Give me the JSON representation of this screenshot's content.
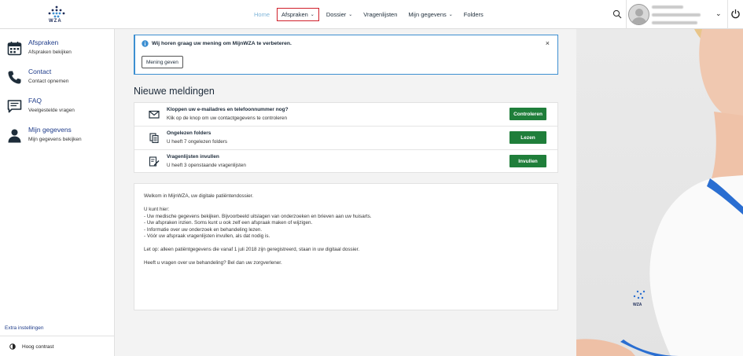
{
  "header": {
    "logo_text": "WZA",
    "nav": [
      {
        "label": "Home",
        "has_menu": false
      },
      {
        "label": "Afspraken",
        "has_menu": true
      },
      {
        "label": "Dossier",
        "has_menu": true
      },
      {
        "label": "Vragenlijsten",
        "has_menu": false
      },
      {
        "label": "Mijn gegevens",
        "has_menu": true
      },
      {
        "label": "Folders",
        "has_menu": false
      }
    ]
  },
  "sidebar": {
    "items": [
      {
        "title": "Afspraken",
        "subtitle": "Afspraken bekijken",
        "icon": "calendar-icon"
      },
      {
        "title": "Contact",
        "subtitle": "Contact opnemen",
        "icon": "phone-icon"
      },
      {
        "title": "FAQ",
        "subtitle": "Veelgestelde vragen",
        "icon": "chat-icon"
      },
      {
        "title": "Mijn gegevens",
        "subtitle": "Mijn gegevens bekijken",
        "icon": "person-icon"
      }
    ],
    "extra_label": "Extra instellingen",
    "contrast_label": "Hoog contrast"
  },
  "notice": {
    "text": "Wij horen graag uw mening om MijnWZA te verbeteren.",
    "button": "Mening geven"
  },
  "section_title": "Nieuwe meldingen",
  "notifications": [
    {
      "title": "Kloppen uw e-mailadres en telefoonnummer nog?",
      "subtitle": "Klik op de knop om uw contactgegevens te controleren",
      "button": "Controleren",
      "icon": "mail-icon"
    },
    {
      "title": "Ongelezen folders",
      "subtitle": "U heeft 7 ongelezen folders",
      "button": "Lezen",
      "icon": "folders-icon"
    },
    {
      "title": "Vragenlijsten invullen",
      "subtitle": "U heeft 3 openstaande vragenlijsten",
      "button": "Invullen",
      "icon": "form-edit-icon"
    }
  ],
  "welcome": {
    "intro": "Welkom in MijnWZA, uw digitale patiëntendossier.",
    "lead": "U kunt hier:",
    "bullets": [
      "- Uw medische gegevens bekijken. Bijvoorbeeld uitslagen van onderzoeken en brieven aan uw huisarts.",
      "- Uw afspraken inzien. Soms kunt u ook zelf een afspraak maken of wijzigen.",
      "- Informatie over uw onderzoek en behandeling lezen.",
      "- Vóór uw afspraak vragenlijsten invullen, als dat nodig is."
    ],
    "note": "Let op: alleen patiëntgegevens die vanaf 1 juli 2018 zijn geregistreerd, staan in uw digitaal dossier.",
    "question": "Heeft u vragen over uw behandeling? Bel dan uw zorgverlener."
  },
  "colors": {
    "brand_blue": "#1f3c8a",
    "accent_blue": "#3d8fd1",
    "button_green": "#1f7e3a",
    "active_outline": "#d01f2a"
  }
}
